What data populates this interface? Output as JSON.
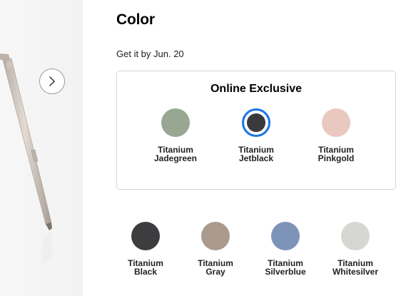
{
  "gallery": {
    "next_icon": "chevron-right-icon"
  },
  "heading": "Color",
  "delivery_text": "Get it by Jun. 20",
  "exclusive": {
    "title": "Online Exclusive",
    "swatches": [
      {
        "line1": "Titanium",
        "line2": "Jadegreen",
        "color": "#97a791"
      },
      {
        "line1": "Titanium",
        "line2": "Jetblack",
        "color": "#3a3a3c",
        "selected": true
      },
      {
        "line1": "Titanium",
        "line2": "Pinkgold",
        "color": "#e9c9bf"
      }
    ]
  },
  "standard": {
    "swatches": [
      {
        "line1": "Titanium",
        "line2": "Black",
        "color": "#3d3d3f"
      },
      {
        "line1": "Titanium",
        "line2": "Gray",
        "color": "#aa9b8e"
      },
      {
        "line1": "Titanium",
        "line2": "Silverblue",
        "color": "#7e93b8"
      },
      {
        "line1": "Titanium",
        "line2": "Whitesilver",
        "color": "#d6d6d3"
      }
    ]
  },
  "colors": {
    "selected_ring": "#1a73e8",
    "box_border": "#d6d6d6",
    "gallery_bg": "#f4f4f4"
  }
}
